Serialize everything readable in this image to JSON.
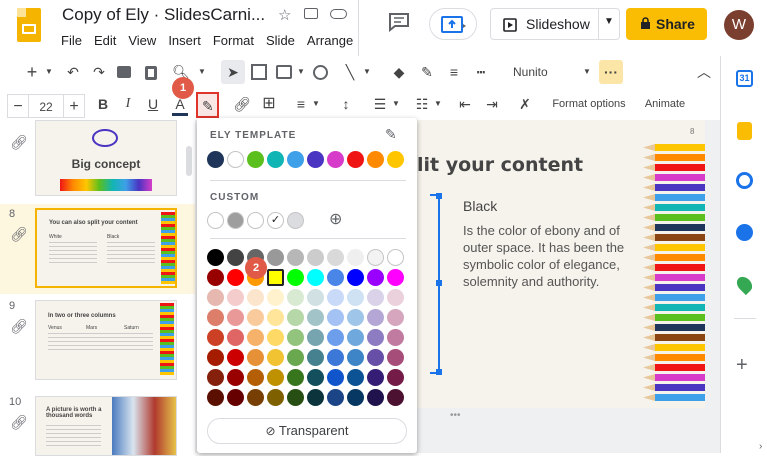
{
  "header": {
    "doc_title": "Copy of Ely · SlidesCarni...",
    "menu": [
      "File",
      "Edit",
      "View",
      "Insert",
      "Format",
      "Slide",
      "Arrange"
    ],
    "slideshow_label": "Slideshow",
    "share_label": "Share",
    "avatar_letter": "W"
  },
  "toolbar": {
    "font_name": "Nunito",
    "font_size": "22",
    "format_options_label": "Format options",
    "animate_label": "Animate"
  },
  "slides": [
    {
      "number": "",
      "title": "Big concept"
    },
    {
      "number": "8",
      "title": "You can also split your content",
      "col1": "White",
      "col2": "Black"
    },
    {
      "number": "9",
      "title": "In two or three columns",
      "col1": "Venus",
      "col2": "Mars",
      "col3": "Saturn"
    },
    {
      "number": "10",
      "title": "A picture is worth a thousand words"
    }
  ],
  "main_slide": {
    "page_number": "8",
    "title": "lit your content",
    "subtitle": "Black",
    "body": "Is the color of ebony and of outer space. It has been the symbolic color of elegance, solemnity and authority."
  },
  "color_picker": {
    "theme_label": "ELY TEMPLATE",
    "custom_label": "CUSTOM",
    "transparent_label": "Transparent",
    "theme_colors": [
      "#1f3559",
      "#ffffff",
      "#5bbf1e",
      "#11b5b3",
      "#3ea0e8",
      "#4a34c2",
      "#d63cc9",
      "#ef1515",
      "#ff8a00",
      "#ffc600"
    ],
    "custom_colors": [
      "#ffffff",
      "#9e9e9e",
      "#ffffff",
      "#ffffff",
      "#dadce0"
    ],
    "grid": [
      [
        "#000000",
        "#434343",
        "#666666",
        "#999999",
        "#b7b7b7",
        "#cccccc",
        "#d9d9d9",
        "#efefef",
        "#f3f3f3",
        "#ffffff"
      ],
      [
        "#980000",
        "#ff0000",
        "#ff9900",
        "#ffff00",
        "#00ff00",
        "#00ffff",
        "#4a86e8",
        "#0000ff",
        "#9900ff",
        "#ff00ff"
      ],
      [
        "#e6b8af",
        "#f4cccc",
        "#fce5cd",
        "#fff2cc",
        "#d9ead3",
        "#d0e0e3",
        "#c9daf8",
        "#cfe2f3",
        "#d9d2e9",
        "#ead1dc"
      ],
      [
        "#dd7e6b",
        "#ea9999",
        "#f9cb9c",
        "#ffe599",
        "#b6d7a8",
        "#a2c4c9",
        "#a4c2f4",
        "#9fc5e8",
        "#b4a7d6",
        "#d5a6bd"
      ],
      [
        "#cc4125",
        "#e06666",
        "#f6b26b",
        "#ffd966",
        "#93c47d",
        "#76a5af",
        "#6d9eeb",
        "#6fa8dc",
        "#8e7cc3",
        "#c27ba0"
      ],
      [
        "#a61c00",
        "#cc0000",
        "#e69138",
        "#f1c232",
        "#6aa84f",
        "#45818e",
        "#3c78d8",
        "#3d85c6",
        "#674ea7",
        "#a64d79"
      ],
      [
        "#85200c",
        "#990000",
        "#b45f06",
        "#bf9000",
        "#38761d",
        "#134f5c",
        "#1155cc",
        "#0b5394",
        "#351c75",
        "#741b47"
      ],
      [
        "#5b0f00",
        "#660000",
        "#783f04",
        "#7f6000",
        "#274e13",
        "#0c343d",
        "#1c4587",
        "#073763",
        "#20124d",
        "#4c1130"
      ]
    ]
  },
  "annotations": {
    "step1": "1",
    "step2": "2"
  },
  "colors": {
    "accent_yellow": "#fbbc04",
    "highlight_red": "#e05a47",
    "selection_blue": "#1a73e8"
  }
}
